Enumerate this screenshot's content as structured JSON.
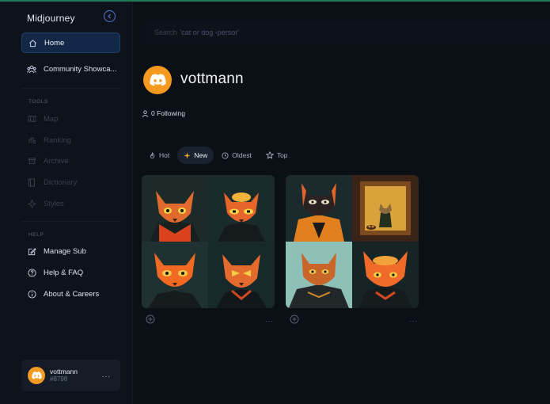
{
  "app": {
    "name": "Midjourney"
  },
  "sidebar": {
    "main_items": [
      {
        "label": "Home",
        "icon": "home-icon"
      },
      {
        "label": "Community Showca...",
        "icon": "community-icon"
      }
    ],
    "tools_label": "TOOLS",
    "tools_items": [
      {
        "label": "Map",
        "icon": "map-icon"
      },
      {
        "label": "Ranking",
        "icon": "ranking-icon"
      },
      {
        "label": "Archive",
        "icon": "archive-icon"
      },
      {
        "label": "Dictionary",
        "icon": "dictionary-icon"
      },
      {
        "label": "Styles",
        "icon": "styles-icon"
      }
    ],
    "help_label": "HELP",
    "help_items": [
      {
        "label": "Manage Sub",
        "icon": "edit-icon"
      },
      {
        "label": "Help & FAQ",
        "icon": "question-icon"
      },
      {
        "label": "About & Careers",
        "icon": "info-icon"
      }
    ],
    "user": {
      "name": "vottmann",
      "tag": "#8798",
      "more": "..."
    }
  },
  "search": {
    "prefix": "Search",
    "keywords": "'cat or dog -persor'"
  },
  "profile": {
    "name": "vottmann",
    "following": "0 Following"
  },
  "sort_tabs": [
    {
      "label": "Hot",
      "icon": "fire-icon"
    },
    {
      "label": "New",
      "icon": "sparkle-icon"
    },
    {
      "label": "Oldest",
      "icon": "clock-icon"
    },
    {
      "label": "Top",
      "icon": "star-icon"
    }
  ],
  "active_sort": "New",
  "colors": {
    "accent_orange": "#f59a1e",
    "active_nav_bg": "#132846",
    "background": "#0b0f16"
  },
  "gallery": {
    "more_label": "..."
  }
}
